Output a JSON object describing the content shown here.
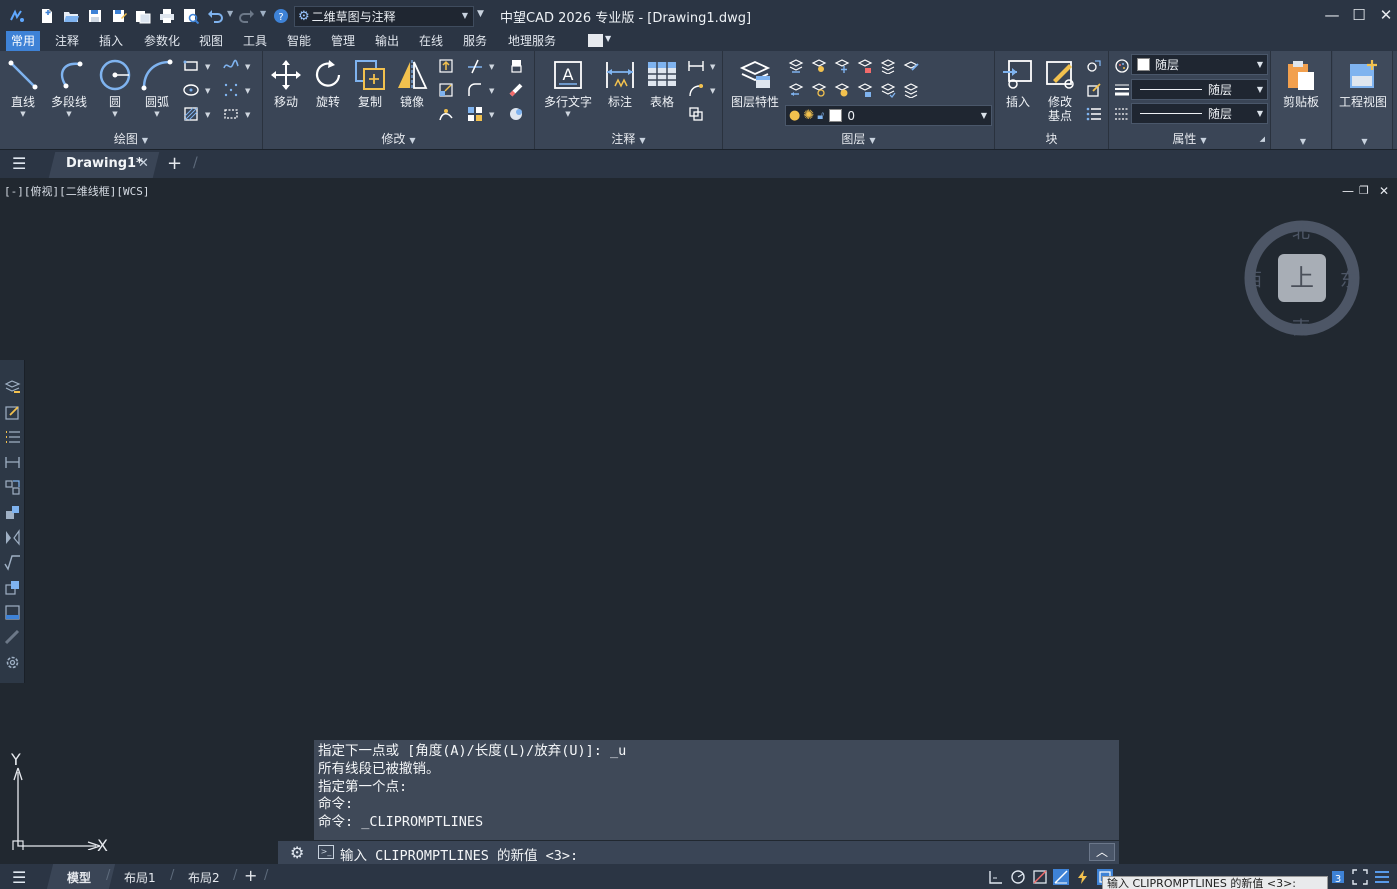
{
  "app": {
    "title": "中望CAD 2026 专业版 - [Drawing1.dwg]",
    "workspace": "二维草图与注释"
  },
  "ribbon_tabs": [
    "常用",
    "注释",
    "插入",
    "参数化",
    "视图",
    "工具",
    "智能",
    "管理",
    "输出",
    "在线",
    "服务",
    "地理服务"
  ],
  "panels": {
    "draw": {
      "title": "绘图",
      "buttons": [
        "直线",
        "多段线",
        "圆",
        "圆弧"
      ]
    },
    "modify": {
      "title": "修改",
      "buttons": [
        "移动",
        "旋转",
        "复制",
        "镜像"
      ]
    },
    "annotation": {
      "title": "注释",
      "buttons": [
        "多行文字",
        "标注",
        "表格"
      ]
    },
    "layers": {
      "title": "图层",
      "props_button": "图层特性",
      "current_layer": "0"
    },
    "block": {
      "title": "块",
      "buttons": [
        "插入",
        "修改\n基点"
      ]
    },
    "properties": {
      "title": "属性",
      "color": "随层",
      "linetype": "随层",
      "lineweight": "随层"
    },
    "clipboard": {
      "label": "剪贴板"
    },
    "engview": {
      "label": "工程视图"
    }
  },
  "document": {
    "tab_label": "Drawing1*"
  },
  "viewport": {
    "label": "[-][俯视][二维线框][WCS]",
    "viewcube": {
      "north": "北",
      "south": "南",
      "east": "东",
      "west": "西",
      "face": "上"
    }
  },
  "ucs": {
    "x": "X",
    "y": "Y"
  },
  "command": {
    "history": [
      "指定下一点或 [角度(A)/长度(L)/放弃(U)]: _u",
      "所有线段已被撤销。",
      "指定第一个点:",
      "命令:",
      "命令: _CLIPROMPTLINES"
    ],
    "prompt": "输入 CLIPROMPTLINES 的新值 <3>:"
  },
  "layout_tabs": [
    "模型",
    "布局1",
    "布局2"
  ],
  "status": {
    "tooltip": "输入 CLIPROMPTLINES 的新值 <3>:"
  },
  "colors": {
    "accent": "#3e82d6",
    "ribbon": "#3a4556",
    "canvas": "#212830"
  }
}
